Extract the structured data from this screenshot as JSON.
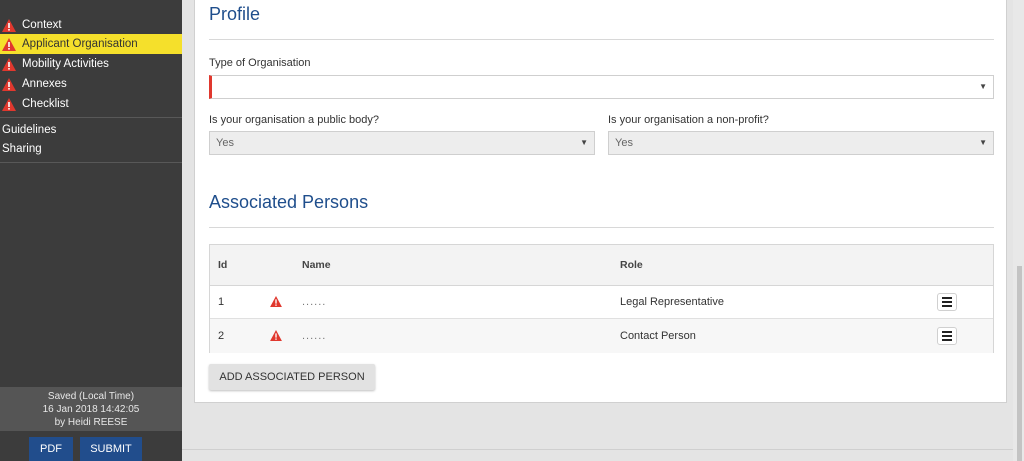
{
  "sidebar": {
    "nav_items": [
      {
        "label": "Context",
        "warning": true,
        "active": false
      },
      {
        "label": "Applicant Organisation",
        "warning": true,
        "active": true
      },
      {
        "label": "Mobility Activities",
        "warning": true,
        "active": false
      },
      {
        "label": "Annexes",
        "warning": true,
        "active": false
      },
      {
        "label": "Checklist",
        "warning": true,
        "active": false
      }
    ],
    "secondary_items": [
      {
        "label": "Guidelines"
      },
      {
        "label": "Sharing"
      }
    ],
    "saved": {
      "line1": "Saved (Local Time)",
      "line2": "16 Jan 2018 14:42:05",
      "line3": "by Heidi REESE"
    },
    "pdf_label": "PDF",
    "submit_label": "SUBMIT"
  },
  "profile": {
    "title": "Profile",
    "type_label": "Type of Organisation",
    "type_value": "",
    "public_body_label": "Is your organisation a public body?",
    "public_body_value": "Yes",
    "non_profit_label": "Is your organisation a non-profit?",
    "non_profit_value": "Yes"
  },
  "persons": {
    "title": "Associated Persons",
    "columns": {
      "id": "Id",
      "name": "Name",
      "role": "Role"
    },
    "rows": [
      {
        "id": "1",
        "name": "......",
        "role": "Legal Representative",
        "warning": true
      },
      {
        "id": "2",
        "name": "......",
        "role": "Contact Person",
        "warning": true
      }
    ],
    "add_label": "ADD ASSOCIATED PERSON"
  },
  "colors": {
    "accent_blue": "#1f4e8c",
    "button_blue": "#214d8c",
    "active_yellow": "#f5e02b",
    "warning_red": "#e0382e",
    "sidebar_bg": "#3c3c3c"
  },
  "icons": {
    "warning": "warning-triangle-icon",
    "menu": "hamburger-menu-icon",
    "caret": "caret-down-icon"
  }
}
